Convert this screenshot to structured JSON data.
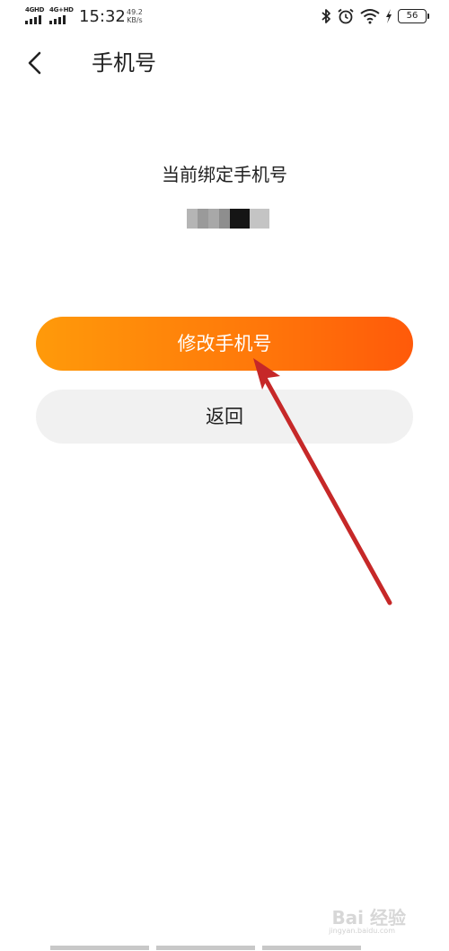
{
  "status_bar": {
    "network1": "4GHD",
    "network2": "4G+HD",
    "time": "15:32",
    "speed_value": "49.2",
    "speed_unit": "KB/s",
    "battery": "56",
    "icons": [
      "bluetooth-icon",
      "alarm-icon",
      "wifi-icon",
      "charging-icon",
      "battery-icon"
    ]
  },
  "header": {
    "back_icon": "chevron-left-icon",
    "title": "手机号"
  },
  "content": {
    "current_label": "当前绑定手机号",
    "phone_masked": true
  },
  "buttons": {
    "change_phone": "修改手机号",
    "back": "返回"
  },
  "colors": {
    "primary_gradient_start": "#ff9a0a",
    "primary_gradient_end": "#ff5a0a",
    "secondary_bg": "#f1f1f1",
    "annotation_arrow": "#c62828"
  },
  "watermark": {
    "text": "Bai 经验",
    "sub": "jingyan.baidu.com"
  }
}
